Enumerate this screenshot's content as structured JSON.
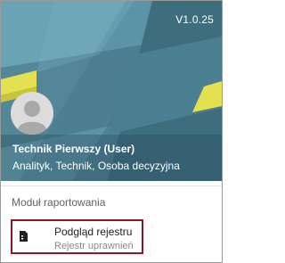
{
  "app": {
    "version": "V1.0.25"
  },
  "user": {
    "name": "Technik Pierwszy (User)",
    "roles": "Analityk, Technik, Osoba decyzyjna"
  },
  "menu": {
    "section_title": "Moduł raportowania",
    "items": [
      {
        "label": "Podgląd rejestru",
        "sublabel": "Rejestr uprawnień",
        "icon": "register-document-icon"
      }
    ]
  },
  "colors": {
    "header_base": "#4a7b8e",
    "header_light": "#5f9ab0",
    "accent_yellow": "#e5e04f",
    "highlight_border": "#8b1a22"
  },
  "icons": {
    "avatar": "default-user-avatar-icon"
  }
}
